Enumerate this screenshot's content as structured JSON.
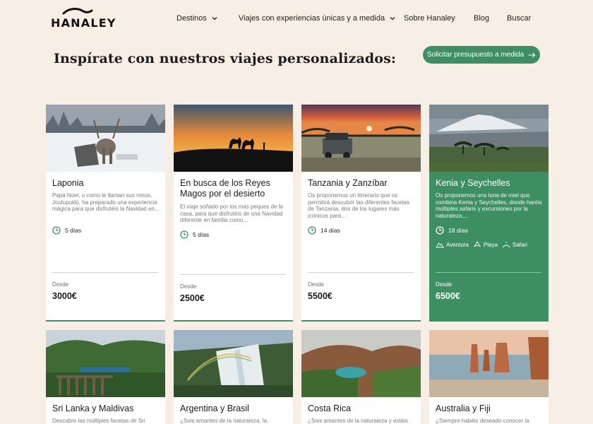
{
  "brand": {
    "name": "HANALEY"
  },
  "nav": {
    "destinos": "Destinos",
    "viajes": "Viajes con experiencias únicas y a medida",
    "sobre": "Sobre Hanaley",
    "blog": "Blog",
    "buscar": "Buscar"
  },
  "page": {
    "title": "Inspírate con nuestros viajes personalizados:",
    "cta": "Solicitar presupuesto a medida"
  },
  "cards": [
    {
      "title": "Laponia",
      "description": "Papá Noel, o como le llaman sus renos, Joulupukki, ha preparado una experiencia mágica para que disfrutéis la Navidad en...",
      "duration": "5 días",
      "from": "Desde",
      "price": "3000€"
    },
    {
      "title": "En busca de los Reyes Magos por el desierto",
      "description": "El viaje soñado por los más peques de la casa, para que disfrutéis de una Navidad diferente en familia como...",
      "duration": "5 días",
      "from": "Desde",
      "price": "2500€"
    },
    {
      "title": "Tanzania y Zanzíbar",
      "description": "Os proponemos un itinerario que os permitirá descubrir las diferentes facetas de Tanzania, dos de los lugares más icónicos para...",
      "duration": "14 días",
      "from": "Desde",
      "price": "5500€"
    },
    {
      "title": "Kenia y Seychelles",
      "description": "Os proponemos una luna de miel que combina Kenia y Seychelles, donde haréis múltiples safaris y excursiones por la naturaleza,...",
      "duration": "18 días",
      "tags": [
        "Aventura",
        "Playa",
        "Safari"
      ],
      "from": "Desde",
      "price": "6500€"
    },
    {
      "title": "Sri Lanka y Maldivas",
      "description": "Descubre las múltiples facetas de Sri"
    },
    {
      "title": "Argentina y Brasil",
      "description": "¿Sois amantes de la naturaleza, la"
    },
    {
      "title": "Costa Rica",
      "description": "¿Sois amantes de la naturaleza y estáis"
    },
    {
      "title": "Australia y Fiji",
      "description": "¿Siempre habéis deseado conocer la"
    }
  ],
  "colors": {
    "accent": "#3d8f63",
    "background": "#f7efe6"
  },
  "icons": {
    "clock": "clock-icon",
    "arrow": "arrow-right-icon",
    "chevron": "chevron-down-icon"
  }
}
